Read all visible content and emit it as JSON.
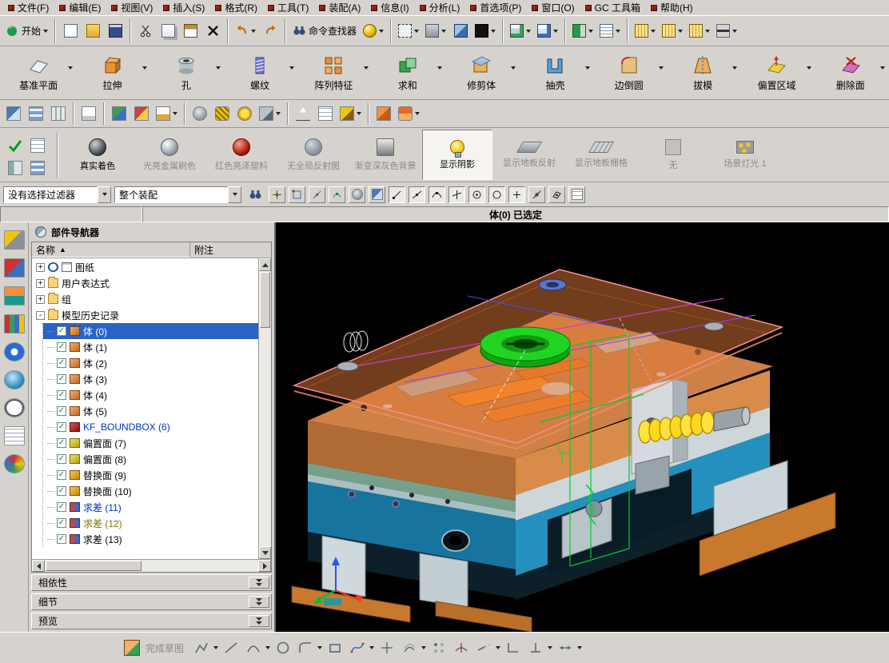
{
  "ui": {
    "dropdown": "▾",
    "sort_asc": "▲",
    "plus": "+",
    "minus": "-",
    "check": "✓"
  },
  "menu_bar": {
    "items": [
      {
        "label": "文件(F)"
      },
      {
        "label": "编辑(E)"
      },
      {
        "label": "视图(V)"
      },
      {
        "label": "插入(S)"
      },
      {
        "label": "格式(R)"
      },
      {
        "label": "工具(T)"
      },
      {
        "label": "装配(A)"
      },
      {
        "label": "信息(I)"
      },
      {
        "label": "分析(L)"
      },
      {
        "label": "首选项(P)"
      },
      {
        "label": "窗口(O)"
      },
      {
        "label": "GC 工具箱"
      },
      {
        "label": "帮助(H)"
      }
    ]
  },
  "standard_toolbar": {
    "start_label": "开始",
    "command_finder_label": "命令查找器",
    "icons": [
      "start-swirl-icon",
      "new-file-icon",
      "open-folder-icon",
      "save-icon",
      "cut-icon",
      "copy-icon",
      "paste-icon",
      "delete-icon",
      "undo-icon",
      "redo-icon",
      "binoculars-icon",
      "sphere-icon",
      "selection-rect-icon",
      "stamp-icon",
      "cube-view-icon",
      "background-swatch-icon",
      "window-icon",
      "window-icon",
      "flag-icon",
      "grid-icon",
      "ruler-icon",
      "span-icon"
    ]
  },
  "feature_toolbar": {
    "buttons": [
      {
        "label": "基准平面",
        "icon": "datum-plane-icon"
      },
      {
        "label": "拉伸",
        "icon": "extrude-icon"
      },
      {
        "label": "孔",
        "icon": "hole-icon"
      },
      {
        "label": "螺纹",
        "icon": "thread-icon"
      },
      {
        "label": "阵列特征",
        "icon": "pattern-feature-icon"
      },
      {
        "label": "求和",
        "icon": "unite-icon"
      },
      {
        "label": "修剪体",
        "icon": "trim-body-icon"
      },
      {
        "label": "抽壳",
        "icon": "shell-icon"
      },
      {
        "label": "边倒圆",
        "icon": "edge-blend-icon"
      },
      {
        "label": "拔模",
        "icon": "draft-icon"
      },
      {
        "label": "偏置区域",
        "icon": "offset-region-icon"
      },
      {
        "label": "删除面",
        "icon": "delete-face-icon"
      }
    ]
  },
  "render_toolbar": {
    "buttons": [
      {
        "label": "真实着色",
        "state": "normal",
        "icon": "shaded-sphere-icon"
      },
      {
        "label": "光亮金属刷色",
        "state": "disabled",
        "icon": "metal-sphere-icon"
      },
      {
        "label": "红色亮泽塑料",
        "state": "disabled",
        "icon": "red-sphere-icon"
      },
      {
        "label": "无全局反射图",
        "state": "disabled",
        "icon": "reflection-sphere-icon"
      },
      {
        "label": "渐变深灰色背景",
        "state": "disabled",
        "icon": "gradient-background-icon"
      },
      {
        "label": "显示阴影",
        "state": "active",
        "icon": "shadow-bulb-icon"
      },
      {
        "label": "显示地板反射",
        "state": "disabled",
        "icon": "floor-reflection-icon"
      },
      {
        "label": "显示地板栅格",
        "state": "disabled",
        "icon": "floor-grid-icon"
      },
      {
        "label": "无",
        "state": "disabled",
        "icon": "none-icon"
      },
      {
        "label": "场景灯光 1",
        "state": "disabled",
        "icon": "scene-lights-icon"
      }
    ]
  },
  "selection_bar": {
    "filter_dropdown": "没有选择过滤器",
    "scope_dropdown": "整个装配",
    "icons": [
      "binoculars-icon",
      "snap-point-icons",
      "selection-toggle-icons",
      "grid-icon"
    ]
  },
  "prompt_bar": {
    "message": "体(0) 已选定"
  },
  "resource_bar": {
    "icons": [
      "assembly-navigator-icon",
      "constraint-navigator-icon",
      "part-navigator-icon",
      "hd3d-tool-icon",
      "info-icon",
      "internet-icon",
      "history-icon",
      "notes-icon",
      "roles-icon"
    ]
  },
  "part_navigator": {
    "title": "部件导航器",
    "columns": {
      "name": "名称",
      "note": "附注"
    },
    "tree": [
      {
        "label": "图纸"
      },
      {
        "label": "用户表达式"
      },
      {
        "label": "组"
      },
      {
        "label": "模型历史记录"
      },
      {
        "label": "体 (0)",
        "selected": true
      },
      {
        "label": "体 (1)"
      },
      {
        "label": "体 (2)"
      },
      {
        "label": "体 (3)"
      },
      {
        "label": "体 (4)"
      },
      {
        "label": "体 (5)"
      },
      {
        "label": "KF_BOUNDBOX (6)"
      },
      {
        "label": "偏置面 (7)"
      },
      {
        "label": "偏置面 (8)"
      },
      {
        "label": "替换面 (9)"
      },
      {
        "label": "替换面 (10)"
      },
      {
        "label": "求差 (11)"
      },
      {
        "label": "求差 (12)"
      },
      {
        "label": "求差 (13)"
      }
    ],
    "sections": [
      {
        "label": "相依性"
      },
      {
        "label": "细节"
      },
      {
        "label": "预览"
      }
    ]
  },
  "sketch_toolbar": {
    "finish_label": "完成草图"
  }
}
